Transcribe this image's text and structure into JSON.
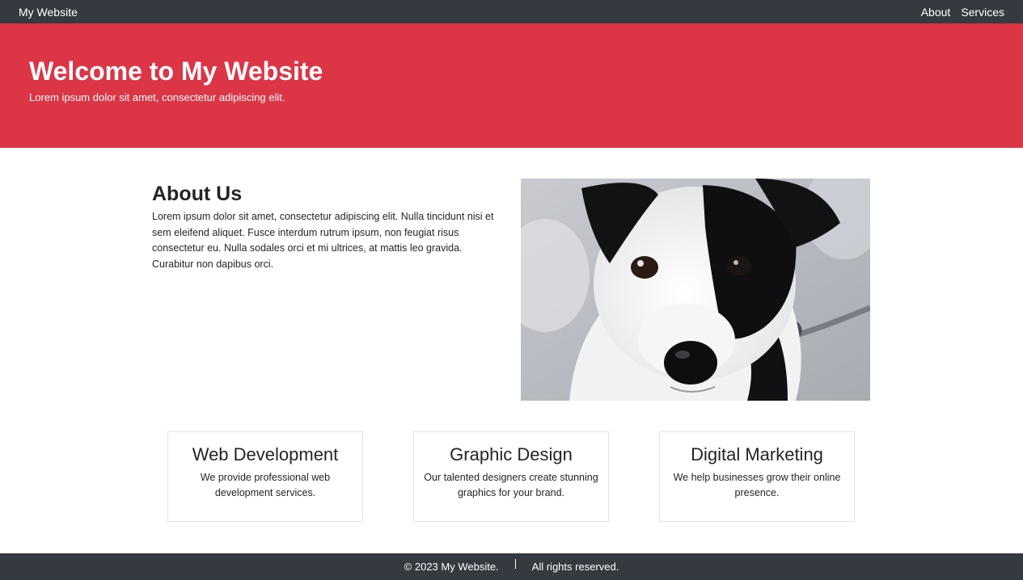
{
  "navbar": {
    "brand": "My Website",
    "links": [
      "About",
      "Services"
    ]
  },
  "hero": {
    "title": "Welcome to My Website",
    "subtitle": "Lorem ipsum dolor sit amet, consectetur adipiscing elit."
  },
  "about": {
    "heading": "About Us",
    "text": "Lorem ipsum dolor sit amet, consectetur adipiscing elit. Nulla tincidunt nisi et sem eleifend aliquet. Fusce interdum rutrum ipsum, non feugiat risus consectetur eu. Nulla sodales orci et mi ultrices, at mattis leo gravida. Curabitur non dapibus orci."
  },
  "services": [
    {
      "title": "Web Development",
      "text": "We provide professional web development services."
    },
    {
      "title": "Graphic Design",
      "text": "Our talented designers create stunning graphics for your brand."
    },
    {
      "title": "Digital Marketing",
      "text": "We help businesses grow their online presence."
    }
  ],
  "footer": {
    "copyright": "© 2023 My Website.",
    "rights": "All rights reserved."
  },
  "colors": {
    "navbar_bg": "#343a40",
    "hero_bg": "#dc3545",
    "footer_bg": "#343a40"
  }
}
